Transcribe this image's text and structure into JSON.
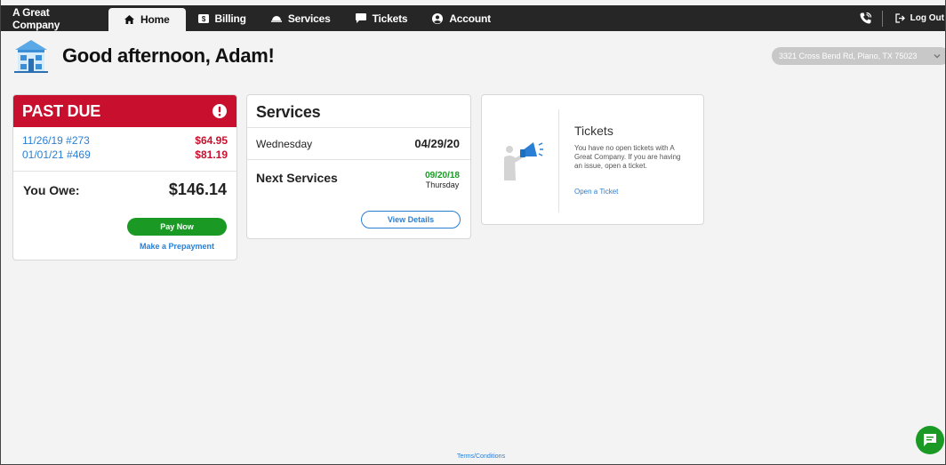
{
  "nav": {
    "brand": "A Great Company",
    "tabs": [
      {
        "label": "Home",
        "icon": "home-icon"
      },
      {
        "label": "Billing",
        "icon": "dollar-icon"
      },
      {
        "label": "Services",
        "icon": "services-icon"
      },
      {
        "label": "Tickets",
        "icon": "chat-bubble-icon"
      },
      {
        "label": "Account",
        "icon": "user-circle-icon"
      }
    ],
    "logout": "Log Out"
  },
  "header": {
    "greeting": "Good afternoon, Adam!",
    "address": "3321 Cross Bend Rd, Plano, TX 75023"
  },
  "past_due": {
    "title": "PAST DUE",
    "invoices": [
      {
        "label": "11/26/19 #273",
        "amount": "$64.95"
      },
      {
        "label": "01/01/21 #469",
        "amount": "$81.19"
      }
    ],
    "owe_label": "You Owe:",
    "owe_amount": "$146.14",
    "pay_now": "Pay Now",
    "prepay": "Make a Prepayment"
  },
  "services": {
    "title": "Services",
    "day": "Wednesday",
    "day_date": "04/29/20",
    "next_label": "Next Services",
    "next_date": "09/20/18",
    "next_weekday": "Thursday",
    "view_details": "View Details"
  },
  "tickets": {
    "title": "Tickets",
    "text": "You have no open tickets with A Great Company. If you are having an issue, open a ticket.",
    "link": "Open a Ticket"
  },
  "footer": {
    "terms": "Terms/Conditions"
  },
  "colors": {
    "nav_bg": "#262626",
    "alert_red": "#c8102e",
    "link_blue": "#2a7fd4",
    "action_green": "#1a9a24"
  }
}
